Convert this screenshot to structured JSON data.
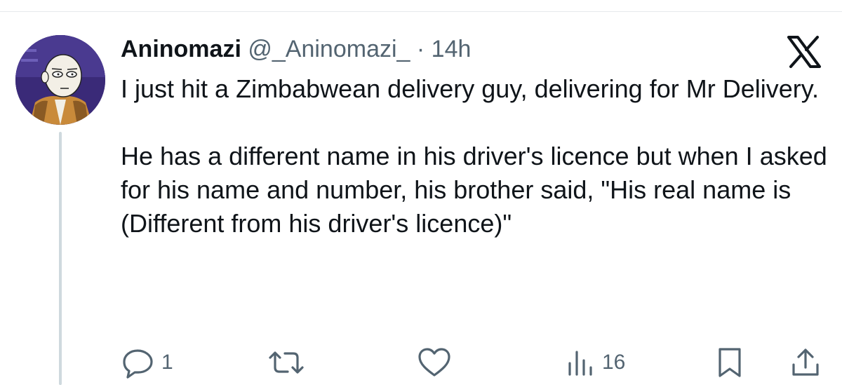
{
  "author": {
    "display_name": "Aninomazi",
    "handle": "@_Aninomazi_",
    "separator": "·",
    "time": "14h"
  },
  "platform_icon": "x-logo-icon",
  "tweet": {
    "paragraphs": [
      "I just hit a Zimbabwean delivery guy, delivering for Mr Delivery.",
      "He has a different name in his driver's licence but when I asked for his name and number, his brother said, \"His real name is (Different from his driver's licence)\""
    ]
  },
  "actions": {
    "reply": {
      "icon": "reply-icon",
      "count": "1"
    },
    "retweet": {
      "icon": "retweet-icon",
      "count": ""
    },
    "like": {
      "icon": "heart-icon",
      "count": ""
    },
    "views": {
      "icon": "views-icon",
      "count": "16"
    },
    "bookmark": {
      "icon": "bookmark-icon"
    },
    "share": {
      "icon": "share-icon"
    }
  },
  "colors": {
    "text_primary": "#0f1419",
    "text_secondary": "#536471",
    "thread_line": "#cfd9de",
    "divider": "#e6e9ec"
  }
}
